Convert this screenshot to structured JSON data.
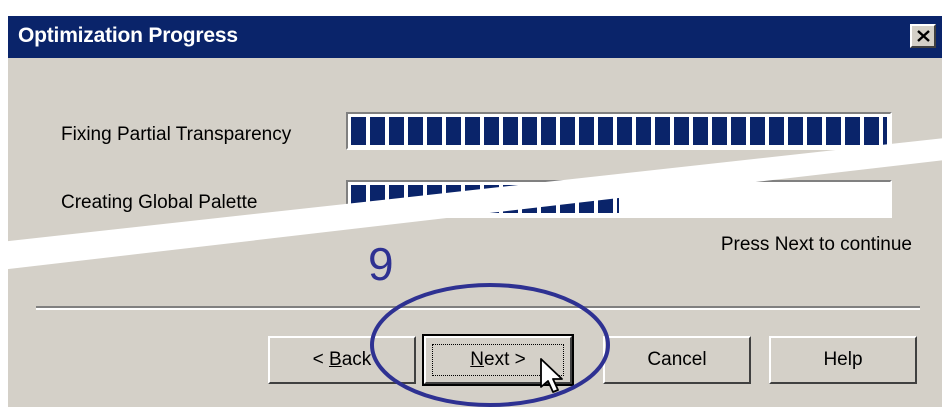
{
  "window": {
    "title": "Optimization Progress",
    "close_icon": "close-icon"
  },
  "tasks": [
    {
      "label": "Fixing Partial Transparency",
      "progress": 1.0
    },
    {
      "label": "Creating Global Palette",
      "progress": 0.5
    }
  ],
  "status": "Press Next to continue",
  "buttons": {
    "back": {
      "mnemonic": "B",
      "rest": "ack",
      "prefix": "< "
    },
    "next": {
      "mnemonic": "N",
      "rest": "ext >"
    },
    "cancel": "Cancel",
    "help": "Help"
  },
  "annotation": {
    "step_number": "9",
    "color": "#2e3192",
    "cursor_icon": "arrow-cursor-icon"
  },
  "colors": {
    "titlebar": "#0a246a",
    "dialog_face": "#d4d0c8",
    "progress_block": "#0a246a"
  }
}
